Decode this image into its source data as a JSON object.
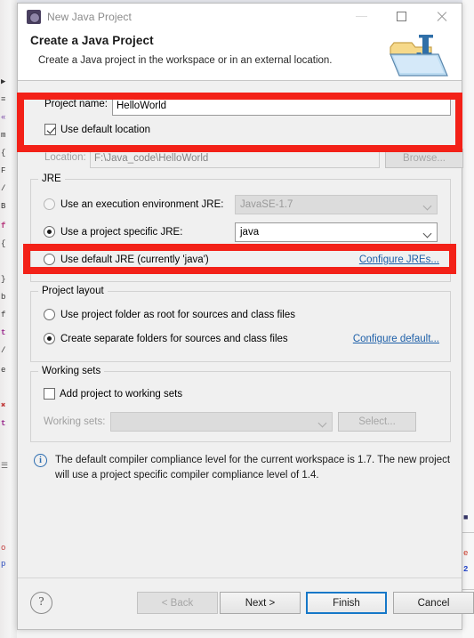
{
  "window": {
    "title": "New Java Project",
    "icon": "eclipse-java-icon",
    "minimize_label": "Minimize",
    "maximize_label": "Maximize",
    "close_label": "Close"
  },
  "header": {
    "title": "Create a Java Project",
    "subtitle": "Create a Java project in the workspace or in an external location.",
    "banner_icon": "java-project-folder-icon"
  },
  "project": {
    "name_label": "Project name:",
    "name_value": "HelloWorld",
    "name_placeholder": "",
    "use_default_location_label": "Use default location",
    "use_default_location_checked": true,
    "location_label": "Location:",
    "location_value": "F:\\Java_code\\HelloWorld",
    "location_enabled": false,
    "browse_label": "Browse...",
    "browse_enabled": false
  },
  "jre": {
    "group_title": "JRE",
    "options": [
      {
        "label": "Use an execution environment JRE:",
        "selected": false,
        "combo_value": "JavaSE-1.7",
        "combo_enabled": false
      },
      {
        "label": "Use a project specific JRE:",
        "selected": true,
        "combo_value": "java",
        "combo_enabled": true
      },
      {
        "label": "Use default JRE (currently 'java')",
        "selected": false
      }
    ],
    "configure_link": "Configure JREs..."
  },
  "layout": {
    "group_title": "Project layout",
    "options": [
      {
        "label": "Use project folder as root for sources and class files",
        "selected": false
      },
      {
        "label": "Create separate folders for sources and class files",
        "selected": true
      }
    ],
    "configure_link": "Configure default..."
  },
  "working_sets": {
    "group_title": "Working sets",
    "add_label": "Add project to working sets",
    "add_checked": false,
    "sets_label": "Working sets:",
    "sets_value": "",
    "sets_enabled": false,
    "select_label": "Select...",
    "select_enabled": false
  },
  "info": {
    "icon": "info-icon",
    "message": "The default compiler compliance level for the current workspace is 1.7. The new project will use a project specific compiler compliance level of 1.4."
  },
  "footer": {
    "help_label": "?",
    "back_label": "< Back",
    "back_enabled": false,
    "next_label": "Next >",
    "next_enabled": true,
    "finish_label": "Finish",
    "finish_focused": true,
    "cancel_label": "Cancel"
  },
  "annotations": {
    "highlight_color": "#f32118",
    "boxes": [
      {
        "name": "project-name-highlight"
      },
      {
        "name": "project-specific-jre-highlight"
      }
    ]
  },
  "backdrop": {
    "left_glyphs": [
      "▶",
      "≡",
      "«",
      "m",
      "{",
      "F",
      "/",
      "B",
      "f",
      "{",
      "}",
      "b",
      "f",
      "t",
      "/",
      "e",
      "✖",
      "t"
    ],
    "right_glyphs": [
      "e",
      "2"
    ]
  }
}
